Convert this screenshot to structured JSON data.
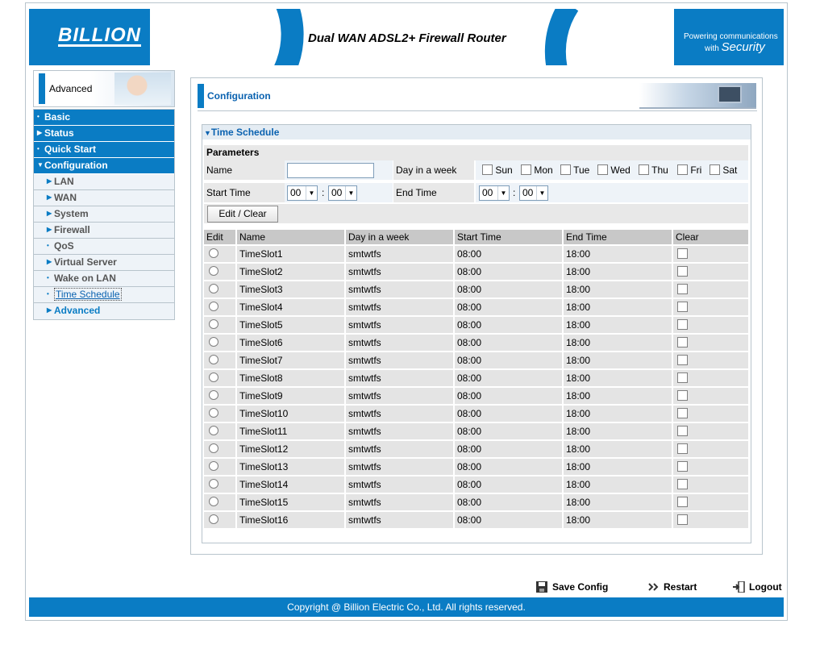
{
  "header": {
    "logo": "BILLION",
    "product_title": "Dual WAN ADSL2+ Firewall Router",
    "tagline_line1": "Powering communications",
    "tagline_line2_small": "with",
    "tagline_line2_big": "Security",
    "colors": {
      "brand_blue": "#0a7cc4"
    }
  },
  "sidebar": {
    "header_label": "Advanced",
    "items": [
      {
        "label": "Basic"
      },
      {
        "label": "Status"
      },
      {
        "label": "Quick Start"
      },
      {
        "label": "Configuration"
      },
      {
        "label": "LAN"
      },
      {
        "label": "WAN"
      },
      {
        "label": "System"
      },
      {
        "label": "Firewall"
      },
      {
        "label": "QoS"
      },
      {
        "label": "Virtual Server"
      },
      {
        "label": "Wake on LAN"
      },
      {
        "label": "Time Schedule"
      },
      {
        "label": "Advanced"
      }
    ]
  },
  "main": {
    "title": "Configuration",
    "section_title": "Time Schedule",
    "parameters_label": "Parameters",
    "form": {
      "name_label": "Name",
      "name_value": "",
      "day_label": "Day in a week",
      "days": [
        "Sun",
        "Mon",
        "Tue",
        "Wed",
        "Thu",
        "Fri",
        "Sat"
      ],
      "start_label": "Start Time",
      "start_hour": "00",
      "start_min": "00",
      "end_label": "End Time",
      "end_hour": "00",
      "end_min": "00",
      "colon": ":"
    },
    "edit_clear_label": "Edit / Clear",
    "table": {
      "headers": [
        "Edit",
        "Name",
        "Day in a week",
        "Start Time",
        "End Time",
        "Clear"
      ],
      "rows": [
        {
          "name": "TimeSlot1",
          "days": "smtwtfs",
          "start": "08:00",
          "end": "18:00"
        },
        {
          "name": "TimeSlot2",
          "days": "smtwtfs",
          "start": "08:00",
          "end": "18:00"
        },
        {
          "name": "TimeSlot3",
          "days": "smtwtfs",
          "start": "08:00",
          "end": "18:00"
        },
        {
          "name": "TimeSlot4",
          "days": "smtwtfs",
          "start": "08:00",
          "end": "18:00"
        },
        {
          "name": "TimeSlot5",
          "days": "smtwtfs",
          "start": "08:00",
          "end": "18:00"
        },
        {
          "name": "TimeSlot6",
          "days": "smtwtfs",
          "start": "08:00",
          "end": "18:00"
        },
        {
          "name": "TimeSlot7",
          "days": "smtwtfs",
          "start": "08:00",
          "end": "18:00"
        },
        {
          "name": "TimeSlot8",
          "days": "smtwtfs",
          "start": "08:00",
          "end": "18:00"
        },
        {
          "name": "TimeSlot9",
          "days": "smtwtfs",
          "start": "08:00",
          "end": "18:00"
        },
        {
          "name": "TimeSlot10",
          "days": "smtwtfs",
          "start": "08:00",
          "end": "18:00"
        },
        {
          "name": "TimeSlot11",
          "days": "smtwtfs",
          "start": "08:00",
          "end": "18:00"
        },
        {
          "name": "TimeSlot12",
          "days": "smtwtfs",
          "start": "08:00",
          "end": "18:00"
        },
        {
          "name": "TimeSlot13",
          "days": "smtwtfs",
          "start": "08:00",
          "end": "18:00"
        },
        {
          "name": "TimeSlot14",
          "days": "smtwtfs",
          "start": "08:00",
          "end": "18:00"
        },
        {
          "name": "TimeSlot15",
          "days": "smtwtfs",
          "start": "08:00",
          "end": "18:00"
        },
        {
          "name": "TimeSlot16",
          "days": "smtwtfs",
          "start": "08:00",
          "end": "18:00"
        }
      ]
    }
  },
  "bottom": {
    "save_config": "Save Config",
    "restart": "Restart",
    "logout": "Logout",
    "copyright": "Copyright @ Billion Electric Co., Ltd. All rights reserved."
  }
}
